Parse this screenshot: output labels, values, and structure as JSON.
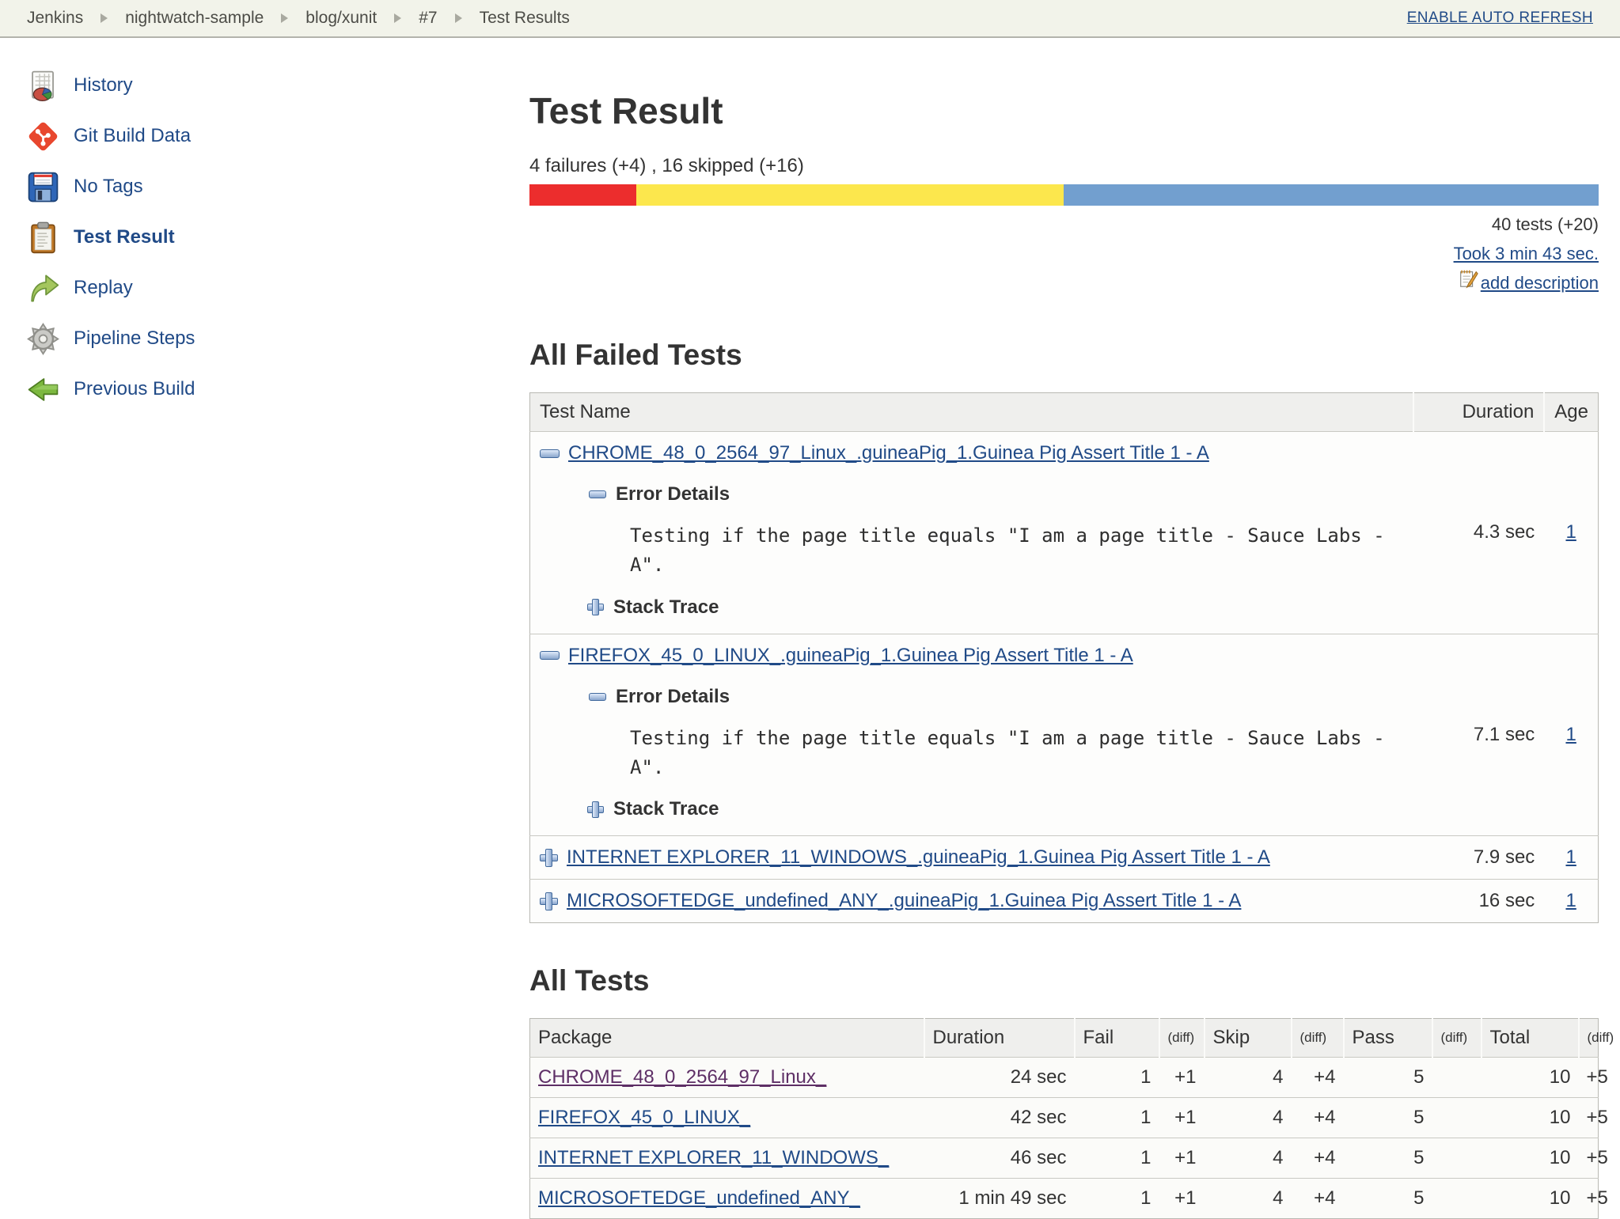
{
  "breadcrumb": {
    "items": [
      "Jenkins",
      "nightwatch-sample",
      "blog/xunit",
      "#7",
      "Test Results"
    ],
    "auto_refresh": "ENABLE AUTO REFRESH"
  },
  "sidebar": {
    "items": [
      {
        "label": "History",
        "icon": "history-icon"
      },
      {
        "label": "Git Build Data",
        "icon": "git-icon"
      },
      {
        "label": "No Tags",
        "icon": "save-icon"
      },
      {
        "label": "Test Result",
        "icon": "clipboard-icon"
      },
      {
        "label": "Replay",
        "icon": "replay-icon"
      },
      {
        "label": "Pipeline Steps",
        "icon": "gear-icon"
      },
      {
        "label": "Previous Build",
        "icon": "previous-build-icon"
      }
    ]
  },
  "header": {
    "title": "Test Result",
    "failures_line": "4 failures (+4) , 16 skipped (+16)",
    "tests_count": "40 tests (+20)",
    "took": "Took 3 min 43 sec.",
    "add_description": "add description",
    "bar": {
      "fail_pct": 10,
      "skip_pct": 40,
      "pass_pct": 50,
      "fail_color": "#ec2d2d",
      "skip_color": "#fce74d",
      "pass_color": "#729fcf"
    }
  },
  "failed_tests": {
    "heading": "All Failed Tests",
    "columns": [
      "Test Name",
      "Duration",
      "Age"
    ],
    "rows": [
      {
        "name": "CHROME_48_0_2564_97_Linux_.guineaPig_1.Guinea Pig Assert Title 1 - A",
        "error_details_label": "Error Details",
        "error_text": "Testing if the page title equals \"I am a page title - Sauce Labs - A\".",
        "stack_trace_label": "Stack Trace",
        "duration": "4.3 sec",
        "age": "1"
      },
      {
        "name": "FIREFOX_45_0_LINUX_.guineaPig_1.Guinea Pig Assert Title 1 - A",
        "error_details_label": "Error Details",
        "error_text": "Testing if the page title equals \"I am a page title - Sauce Labs - A\".",
        "stack_trace_label": "Stack Trace",
        "duration": "7.1 sec",
        "age": "1"
      },
      {
        "name": "INTERNET EXPLORER_11_WINDOWS_.guineaPig_1.Guinea Pig Assert Title 1 - A",
        "duration": "7.9 sec",
        "age": "1"
      },
      {
        "name": "MICROSOFTEDGE_undefined_ANY_.guineaPig_1.Guinea Pig Assert Title 1 - A",
        "duration": "16 sec",
        "age": "1"
      }
    ]
  },
  "all_tests": {
    "heading": "All Tests",
    "columns": [
      "Package",
      "Duration",
      "Fail",
      "(diff)",
      "Skip",
      "(diff)",
      "Pass",
      "(diff)",
      "Total",
      "(diff)"
    ],
    "rows": [
      {
        "package": "CHROME_48_0_2564_97_Linux_",
        "duration": "24 sec",
        "fail": "1",
        "fail_diff": "+1",
        "skip": "4",
        "skip_diff": "+4",
        "pass": "5",
        "pass_diff": "",
        "total": "10",
        "total_diff": "+5"
      },
      {
        "package": "FIREFOX_45_0_LINUX_",
        "duration": "42 sec",
        "fail": "1",
        "fail_diff": "+1",
        "skip": "4",
        "skip_diff": "+4",
        "pass": "5",
        "pass_diff": "",
        "total": "10",
        "total_diff": "+5"
      },
      {
        "package": "INTERNET EXPLORER_11_WINDOWS_",
        "duration": "46 sec",
        "fail": "1",
        "fail_diff": "+1",
        "skip": "4",
        "skip_diff": "+4",
        "pass": "5",
        "pass_diff": "",
        "total": "10",
        "total_diff": "+5"
      },
      {
        "package": "MICROSOFTEDGE_undefined_ANY_",
        "duration": "1 min 49 sec",
        "fail": "1",
        "fail_diff": "+1",
        "skip": "4",
        "skip_diff": "+4",
        "pass": "5",
        "pass_diff": "",
        "total": "10",
        "total_diff": "+5"
      }
    ]
  }
}
